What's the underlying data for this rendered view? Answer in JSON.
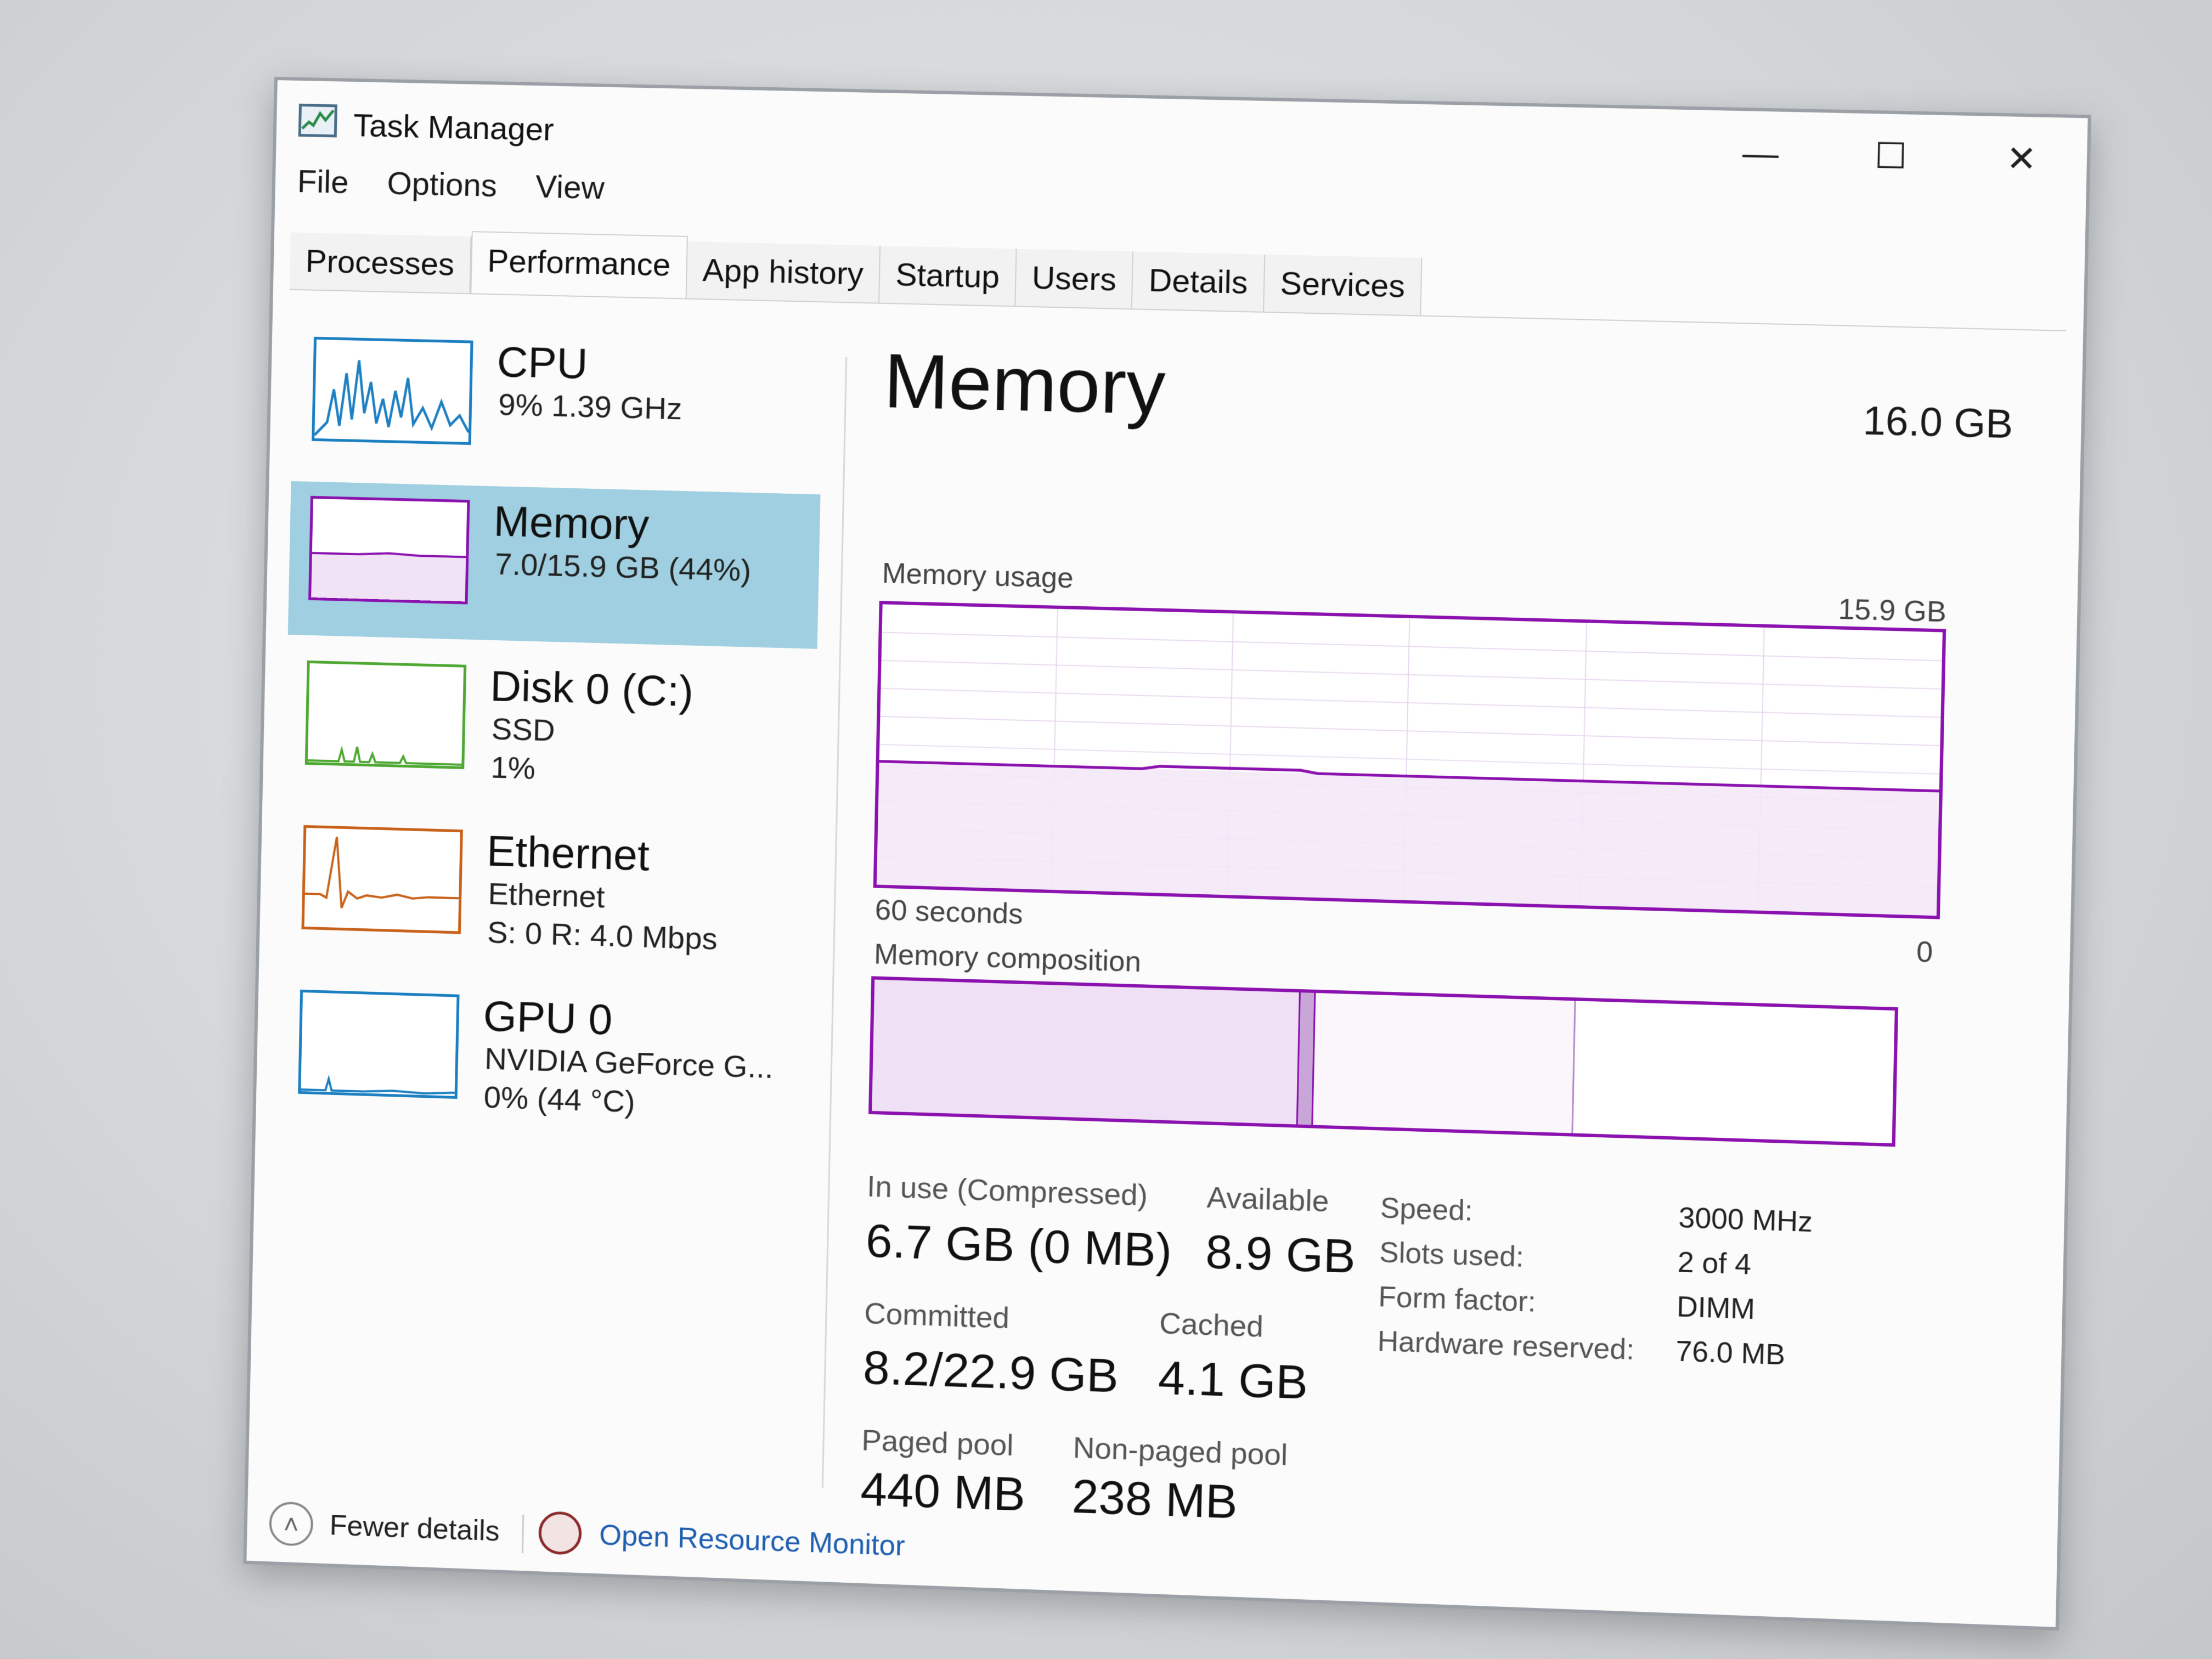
{
  "window": {
    "title": "Task Manager",
    "controls": {
      "minimize": "—",
      "maximize": "☐",
      "close": "✕"
    }
  },
  "menu": [
    "File",
    "Options",
    "View"
  ],
  "tabs": [
    "Processes",
    "Performance",
    "App history",
    "Startup",
    "Users",
    "Details",
    "Services"
  ],
  "active_tab": "Performance",
  "sidebar": {
    "items": [
      {
        "name": "CPU",
        "lines": [
          "9%  1.39 GHz"
        ],
        "color": "#1b7fc1"
      },
      {
        "name": "Memory",
        "lines": [
          "7.0/15.9 GB (44%)"
        ],
        "color": "#8b12ae"
      },
      {
        "name": "Disk 0 (C:)",
        "lines": [
          "SSD",
          "1%"
        ],
        "color": "#4ea832"
      },
      {
        "name": "Ethernet",
        "lines": [
          "Ethernet",
          "S: 0  R: 4.0 Mbps"
        ],
        "color": "#c8621b"
      },
      {
        "name": "GPU 0",
        "lines": [
          "NVIDIA GeForce G...",
          "0%  (44 °C)"
        ],
        "color": "#1b7fc1"
      }
    ]
  },
  "main": {
    "title": "Memory",
    "total": "16.0 GB",
    "usage_label": "Memory usage",
    "usage_max": "15.9 GB",
    "time_label": "60 seconds",
    "zero_label": "0",
    "composition_label": "Memory composition",
    "usage_level": 0.44,
    "composition": {
      "in_use": 0.42,
      "modified": 0.015,
      "standby": 0.255,
      "free": 0.31
    },
    "stats": {
      "in_use_label": "In use (Compressed)",
      "in_use_value": "6.7 GB (0 MB)",
      "available_label": "Available",
      "available_value": "8.9 GB",
      "committed_label": "Committed",
      "committed_value": "8.2/22.9 GB",
      "cached_label": "Cached",
      "cached_value": "4.1 GB",
      "paged_label": "Paged pool",
      "paged_value": "440 MB",
      "nonpaged_label": "Non-paged pool",
      "nonpaged_value": "238 MB"
    },
    "specs": {
      "speed_label": "Speed:",
      "speed_value": "3000 MHz",
      "slots_label": "Slots used:",
      "slots_value": "2 of 4",
      "form_label": "Form factor:",
      "form_value": "DIMM",
      "hw_label": "Hardware reserved:",
      "hw_value": "76.0 MB"
    }
  },
  "footer": {
    "fewer": "Fewer details",
    "resource_monitor": "Open Resource Monitor"
  }
}
